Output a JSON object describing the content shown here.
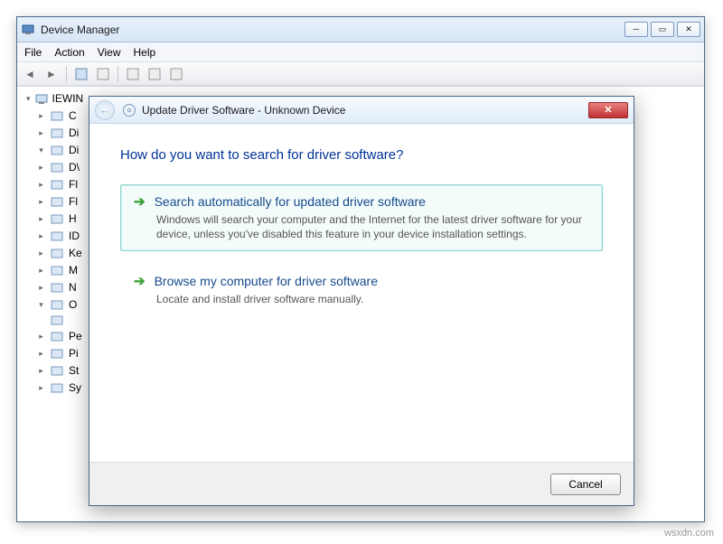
{
  "dm": {
    "title": "Device Manager",
    "menu": [
      "File",
      "Action",
      "View",
      "Help"
    ],
    "tree_root": "IEWIN",
    "nodes": [
      {
        "label": "C",
        "expand": "▸"
      },
      {
        "label": "Di",
        "expand": "▸"
      },
      {
        "label": "Di",
        "expand": "▾"
      },
      {
        "label": "D\\",
        "expand": "▸"
      },
      {
        "label": "Fl",
        "expand": "▸"
      },
      {
        "label": "Fl",
        "expand": "▸"
      },
      {
        "label": "H",
        "expand": "▸"
      },
      {
        "label": "ID",
        "expand": "▸"
      },
      {
        "label": "Ke",
        "expand": "▸"
      },
      {
        "label": "M",
        "expand": "▸"
      },
      {
        "label": "N",
        "expand": "▸"
      },
      {
        "label": "O",
        "expand": "▾"
      },
      {
        "label": "",
        "expand": ""
      },
      {
        "label": "Pe",
        "expand": "▸"
      },
      {
        "label": "Pi",
        "expand": "▸"
      },
      {
        "label": "St",
        "expand": "▸"
      },
      {
        "label": "Sy",
        "expand": "▸"
      }
    ]
  },
  "dlg": {
    "title": "Update Driver Software - Unknown Device",
    "heading": "How do you want to search for driver software?",
    "opt1": {
      "title": "Search automatically for updated driver software",
      "desc": "Windows will search your computer and the Internet for the latest driver software for your device, unless you've disabled this feature in your device installation settings."
    },
    "opt2": {
      "title": "Browse my computer for driver software",
      "desc": "Locate and install driver software manually."
    },
    "cancel": "Cancel"
  },
  "watermark": "wsxdn.com"
}
